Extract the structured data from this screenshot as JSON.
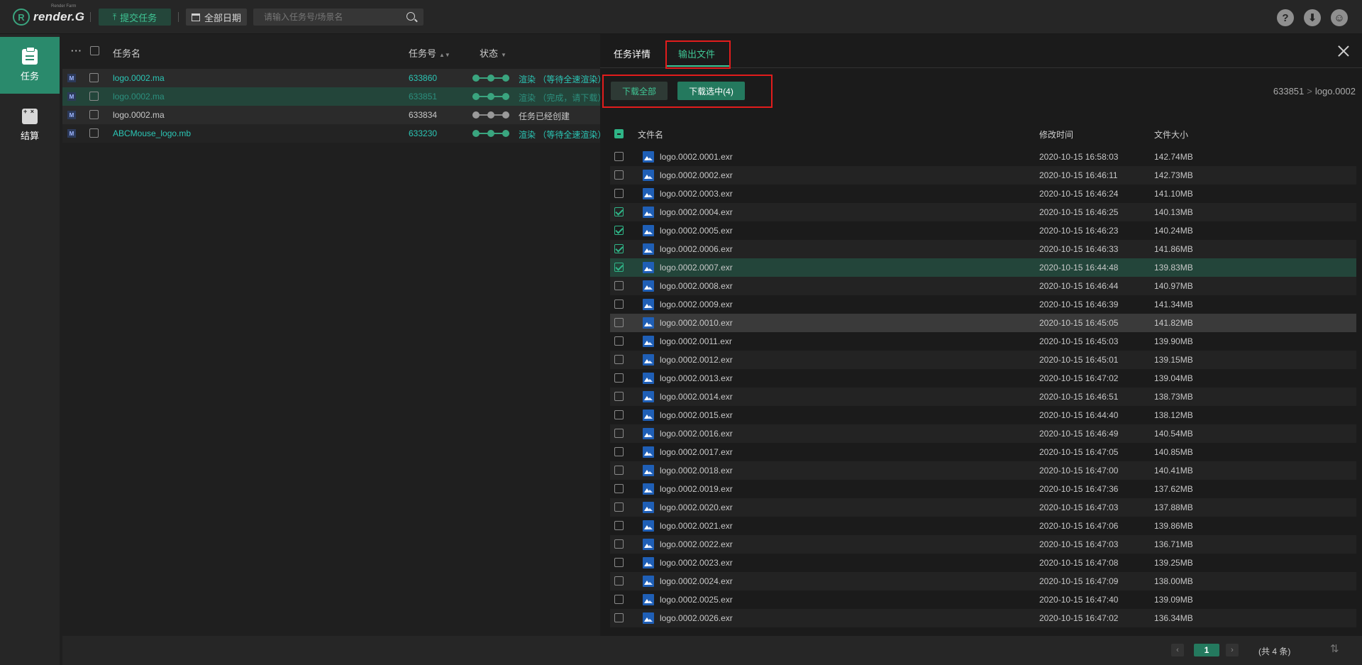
{
  "header": {
    "logo_mark": "R",
    "logo_text": "render.G",
    "logo_sub": "Render Farm",
    "submit_label": "提交任务",
    "date_label": "全部日期",
    "search_placeholder": "请输入任务号/场景名"
  },
  "nav": {
    "items": [
      {
        "label": "任务"
      },
      {
        "label": "结算"
      }
    ]
  },
  "task_list": {
    "columns": {
      "dots": "···",
      "name": "任务名",
      "id": "任务号",
      "state": "状态"
    },
    "rows": [
      {
        "tag": "M",
        "name": "logo.0002.ma",
        "id": "633860",
        "status": "渲染 （等待全速渲染）",
        "color": "#2bc6b5"
      },
      {
        "tag": "M",
        "name": "logo.0002.ma",
        "id": "633851",
        "status": "渲染 （完成，请下载）",
        "color": "#2c8f7e"
      },
      {
        "tag": "M",
        "name": "logo.0002.ma",
        "id": "633834",
        "status": "任务已经创建",
        "color": "#c8c8c8"
      },
      {
        "tag": "M",
        "name": "ABCMouse_logo.mb",
        "id": "633230",
        "status": "渲染 （等待全速渲染）",
        "color": "#2bc6b5"
      }
    ]
  },
  "panel": {
    "tab_detail": "任务详情",
    "tab_output": "输出文件",
    "download_all": "下载全部",
    "download_selected": "下载选中(4)",
    "breadcrumb_task": "633851",
    "breadcrumb_name": "logo.0002",
    "columns": {
      "name": "文件名",
      "time": "修改时间",
      "size": "文件大小"
    },
    "files": [
      {
        "name": "logo.0002.0001.exr",
        "time": "2020-10-15 16:58:03",
        "size": "142.74MB",
        "checked": false
      },
      {
        "name": "logo.0002.0002.exr",
        "time": "2020-10-15 16:46:11",
        "size": "142.73MB",
        "checked": false
      },
      {
        "name": "logo.0002.0003.exr",
        "time": "2020-10-15 16:46:24",
        "size": "141.10MB",
        "checked": false
      },
      {
        "name": "logo.0002.0004.exr",
        "time": "2020-10-15 16:46:25",
        "size": "140.13MB",
        "checked": true
      },
      {
        "name": "logo.0002.0005.exr",
        "time": "2020-10-15 16:46:23",
        "size": "140.24MB",
        "checked": true
      },
      {
        "name": "logo.0002.0006.exr",
        "time": "2020-10-15 16:46:33",
        "size": "141.86MB",
        "checked": true
      },
      {
        "name": "logo.0002.0007.exr",
        "time": "2020-10-15 16:44:48",
        "size": "139.83MB",
        "checked": true
      },
      {
        "name": "logo.0002.0008.exr",
        "time": "2020-10-15 16:46:44",
        "size": "140.97MB",
        "checked": false
      },
      {
        "name": "logo.0002.0009.exr",
        "time": "2020-10-15 16:46:39",
        "size": "141.34MB",
        "checked": false
      },
      {
        "name": "logo.0002.0010.exr",
        "time": "2020-10-15 16:45:05",
        "size": "141.82MB",
        "checked": false
      },
      {
        "name": "logo.0002.0011.exr",
        "time": "2020-10-15 16:45:03",
        "size": "139.90MB",
        "checked": false
      },
      {
        "name": "logo.0002.0012.exr",
        "time": "2020-10-15 16:45:01",
        "size": "139.15MB",
        "checked": false
      },
      {
        "name": "logo.0002.0013.exr",
        "time": "2020-10-15 16:47:02",
        "size": "139.04MB",
        "checked": false
      },
      {
        "name": "logo.0002.0014.exr",
        "time": "2020-10-15 16:46:51",
        "size": "138.73MB",
        "checked": false
      },
      {
        "name": "logo.0002.0015.exr",
        "time": "2020-10-15 16:44:40",
        "size": "138.12MB",
        "checked": false
      },
      {
        "name": "logo.0002.0016.exr",
        "time": "2020-10-15 16:46:49",
        "size": "140.54MB",
        "checked": false
      },
      {
        "name": "logo.0002.0017.exr",
        "time": "2020-10-15 16:47:05",
        "size": "140.85MB",
        "checked": false
      },
      {
        "name": "logo.0002.0018.exr",
        "time": "2020-10-15 16:47:00",
        "size": "140.41MB",
        "checked": false
      },
      {
        "name": "logo.0002.0019.exr",
        "time": "2020-10-15 16:47:36",
        "size": "137.62MB",
        "checked": false
      },
      {
        "name": "logo.0002.0020.exr",
        "time": "2020-10-15 16:47:03",
        "size": "137.88MB",
        "checked": false
      },
      {
        "name": "logo.0002.0021.exr",
        "time": "2020-10-15 16:47:06",
        "size": "139.86MB",
        "checked": false
      },
      {
        "name": "logo.0002.0022.exr",
        "time": "2020-10-15 16:47:03",
        "size": "136.71MB",
        "checked": false
      },
      {
        "name": "logo.0002.0023.exr",
        "time": "2020-10-15 16:47:08",
        "size": "139.25MB",
        "checked": false
      },
      {
        "name": "logo.0002.0024.exr",
        "time": "2020-10-15 16:47:09",
        "size": "138.00MB",
        "checked": false
      },
      {
        "name": "logo.0002.0025.exr",
        "time": "2020-10-15 16:47:40",
        "size": "139.09MB",
        "checked": false
      },
      {
        "name": "logo.0002.0026.exr",
        "time": "2020-10-15 16:47:02",
        "size": "136.34MB",
        "checked": false
      }
    ]
  },
  "pagination": {
    "prev": "‹",
    "current": "1",
    "next": "›",
    "total": "(共 4 条)"
  },
  "icons": {
    "help": "?",
    "download": "⬇",
    "user": "☺",
    "sort": "⇅"
  },
  "colors": {
    "accent": "#3fc695",
    "accent_dark": "#24795e",
    "highlight_box": "#e21c1c"
  }
}
